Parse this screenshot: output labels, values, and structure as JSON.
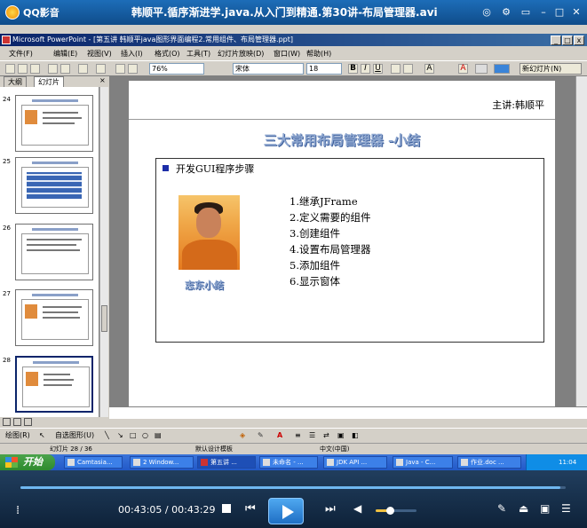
{
  "player": {
    "brand": "QQ影音",
    "video_title": "韩顺平.循序渐进学.java.从入门到精通.第30讲-布局管理器.avi"
  },
  "ppt": {
    "window_title": "Microsoft PowerPoint - [第五讲 韩顺平java图形界面编程2.常用组件、布局管理器.ppt]",
    "menu": [
      "文件(F)",
      "编辑(E)",
      "视图(V)",
      "插入(I)",
      "格式(O)",
      "工具(T)",
      "幻灯片放映(D)",
      "窗口(W)",
      "帮助(H)"
    ],
    "zoom": "76%",
    "font": "宋体",
    "font_size": "18",
    "new_slide_label": "新幻灯片(N)",
    "tabs": [
      "大纲",
      "幻灯片"
    ],
    "thumb_numbers": [
      "24",
      "25",
      "26",
      "27",
      "28"
    ],
    "notes_text": "",
    "status": {
      "slide": "幻灯片 28 / 36",
      "design": "默认设计模板",
      "lang": "中文(中国)"
    },
    "draw_label": "绘图(R)",
    "autoshape_label": "自选图形(U)"
  },
  "slide": {
    "author": "主讲:韩顺平",
    "title": "三大常用布局管理器 -小结",
    "heading": "开发GUI程序步骤",
    "photo_caption": "志东小结",
    "steps": [
      "1.继承JFrame",
      "2.定义需要的组件",
      "3.创建组件",
      "4.设置布局管理器",
      "5.添加组件",
      "6.显示窗体"
    ]
  },
  "taskbar": {
    "start_label": "开始",
    "tasks": [
      "Camtasia...",
      "2 Window...",
      "第五讲 ...",
      "未命名 - ...",
      "JDK API ...",
      "Java - C...",
      "作业.doc ..."
    ],
    "clock": "11:04"
  },
  "playback": {
    "current": "00:43:05",
    "separator": " / ",
    "total": "00:43:29",
    "progress": 0.99,
    "volume": 0.35
  },
  "colors": {
    "accent": "#1f6fc4",
    "title_blue": "#8da6cf",
    "start_green": "#2e8b2e"
  }
}
